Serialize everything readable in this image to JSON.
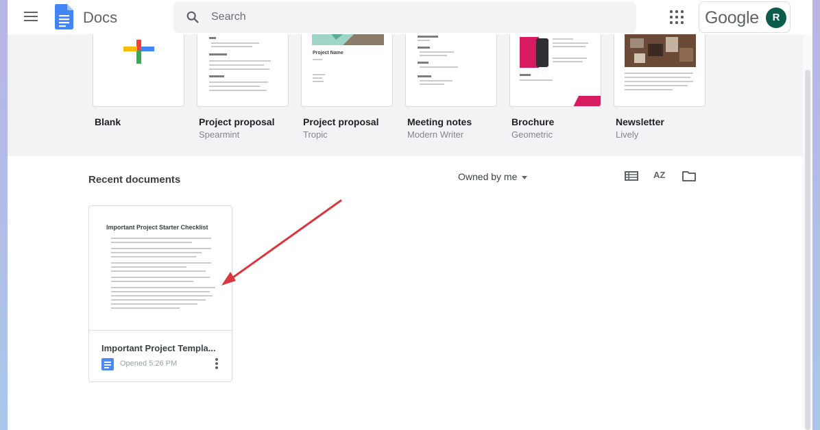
{
  "header": {
    "app_name": "Docs",
    "search_placeholder": "Search",
    "account_brand": "Google",
    "avatar_initial": "R"
  },
  "templates": [
    {
      "title": "Blank",
      "subtitle": ""
    },
    {
      "title": "Project proposal",
      "subtitle": "Spearmint"
    },
    {
      "title": "Project proposal",
      "subtitle": "Tropic"
    },
    {
      "title": "Meeting notes",
      "subtitle": "Modern Writer"
    },
    {
      "title": "Brochure",
      "subtitle": "Geometric"
    },
    {
      "title": "Newsletter",
      "subtitle": "Lively"
    }
  ],
  "template_thumbnail_text": {
    "tropic_heading": "Project Name"
  },
  "recent": {
    "title": "Recent documents",
    "owner_filter": "Owned by me",
    "sort_label": "AZ"
  },
  "documents": [
    {
      "preview_title": "Important Project Starter Checklist",
      "name": "Important Project Templa...",
      "opened": "Opened 5:26 PM"
    }
  ],
  "colors": {
    "docs_blue": "#4285f4",
    "avatar_green": "#0b5c4a",
    "annotation_arrow": "#d9363e",
    "gallery_bg": "#f1f3f4"
  },
  "icons": [
    "menu-icon",
    "docs-logo-icon",
    "search-icon",
    "apps-grid-icon",
    "list-view-icon",
    "sort-az-icon",
    "folder-icon",
    "more-vert-icon",
    "doc-type-icon"
  ]
}
